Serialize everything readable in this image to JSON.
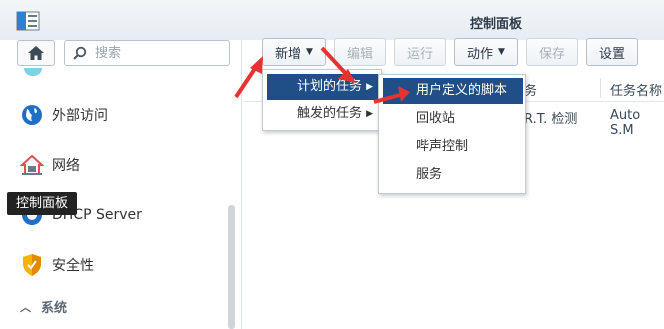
{
  "window": {
    "title": "控制面板"
  },
  "sidebar": {
    "search_placeholder": "搜索",
    "items": [
      {
        "label": "外部访问",
        "icon": "globe-icon"
      },
      {
        "label": "网络",
        "icon": "house-network-icon"
      },
      {
        "label": "DHCP Server",
        "icon": "dhcp-icon"
      },
      {
        "label": "安全性",
        "icon": "shield-icon"
      }
    ],
    "section_label": "系统"
  },
  "tooltip": {
    "text": "控制面板"
  },
  "toolbar": {
    "add_label": "新增",
    "edit_label": "编辑",
    "run_label": "运行",
    "action_label": "动作",
    "save_label": "保存",
    "settings_label": "设置"
  },
  "grid": {
    "headers": [
      "务",
      "任务名称"
    ],
    "row": [
      "R.T. 检测",
      "Auto S.M"
    ]
  },
  "menu_add": {
    "items": [
      {
        "label": "计划的任务",
        "active": true
      },
      {
        "label": "触发的任务",
        "active": false
      }
    ]
  },
  "menu_scheduled": {
    "items": [
      {
        "label": "用户定义的脚本",
        "active": true
      },
      {
        "label": "回收站",
        "active": false
      },
      {
        "label": "哔声控制",
        "active": false
      },
      {
        "label": "服务",
        "active": false
      }
    ]
  },
  "colors": {
    "accent": "#1f4f86",
    "annotation_arrow": "#e8322f"
  }
}
